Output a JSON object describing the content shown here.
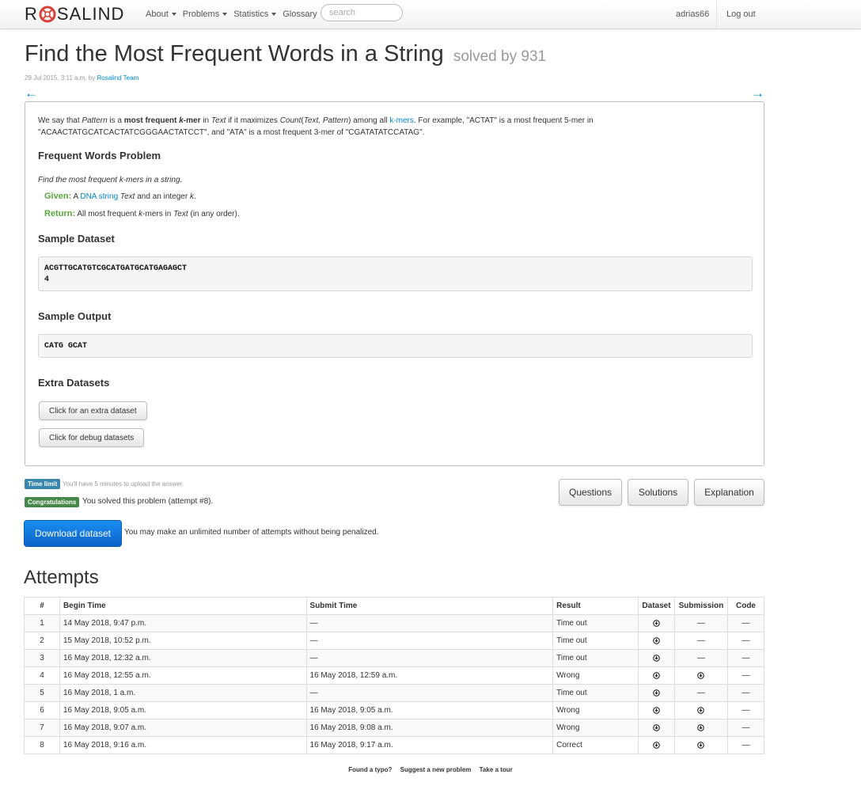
{
  "nav": {
    "brand_left": "R",
    "brand_right": "SALIND",
    "menu": [
      "About",
      "Problems",
      "Statistics",
      "Glossary"
    ],
    "search_placeholder": "search",
    "user": "adrias66",
    "logout": "Log out"
  },
  "problem": {
    "title": "Find the Most Frequent Words in a String",
    "solved_by": "solved by 931",
    "date": "29 Jul 2015, 3:11 a.m. by ",
    "author": "Rosalind Team",
    "prev_arrow": "←",
    "next_arrow": "→",
    "intro": {
      "t1": "We say that ",
      "t2": "Pattern",
      "t3": " is a ",
      "t4": "most frequent ",
      "t5": "k",
      "t6": "-mer",
      "t7": " in ",
      "t8": "Text",
      "t9": " if it maximizes ",
      "t10": "Count",
      "t11": "(",
      "t12": "Text, Pattern",
      "t13": ") among all ",
      "t14": "k-mers",
      "t15": ". For example, \"ACTAT\" is a most frequent 5-mer in \"ACAACTATGCATCACTATCGGGAACTATCCT\", and \"ATA\" is a most frequent 3-mer of \"CGATATATCCATAG\"."
    },
    "section_problem": "Frequent Words Problem",
    "task": "Find the most frequent k-mers in a string.",
    "given_label": "Given:",
    "given_pre": " A ",
    "given_link": "DNA string",
    "given_text": " Text",
    "given_post": " and an integer ",
    "given_k": "k",
    "given_end": ".",
    "return_label": "Return:",
    "return_pre": " All most frequent ",
    "return_k": "k",
    "return_mid": "-mers in ",
    "return_text": "Text",
    "return_post": " (in any order).",
    "section_sample_dataset": "Sample Dataset",
    "sample_dataset_line1": "ACGTTGCATGTCGCATGATGCATGAGAGCT",
    "sample_dataset_line2": "4",
    "section_sample_output": "Sample Output",
    "sample_output": "CATG GCAT",
    "section_extra": "Extra Datasets",
    "extra_button": "Click for an extra dataset",
    "debug_button": "Click for debug datasets"
  },
  "status": {
    "time_limit_badge": "Time limit",
    "time_limit_note": "You'll have 5 minutes to upload the answer.",
    "congrats_badge": "Congratulations",
    "congrats_note": "You solved this problem (attempt #8).",
    "questions": "Questions",
    "solutions": "Solutions",
    "explanation": "Explanation",
    "download": "Download dataset",
    "download_note": "You may make an unlimited number of attempts without being penalized."
  },
  "attempts": {
    "heading": "Attempts",
    "headers": [
      "#",
      "Begin Time",
      "Submit Time",
      "Result",
      "Dataset",
      "Submission",
      "Code"
    ],
    "rows": [
      {
        "n": "1",
        "begin": "14 May 2018, 9:47 p.m.",
        "submit": "—",
        "result": "Time out",
        "submission": "—",
        "code": "—"
      },
      {
        "n": "2",
        "begin": "15 May 2018, 10:52 p.m.",
        "submit": "—",
        "result": "Time out",
        "submission": "—",
        "code": "—"
      },
      {
        "n": "3",
        "begin": "16 May 2018, 12:32 a.m.",
        "submit": "—",
        "result": "Time out",
        "submission": "—",
        "code": "—"
      },
      {
        "n": "4",
        "begin": "16 May 2018, 12:55 a.m.",
        "submit": "16 May 2018, 12:59 a.m.",
        "result": "Wrong",
        "submission": "icon",
        "code": "—"
      },
      {
        "n": "5",
        "begin": "16 May 2018, 1 a.m.",
        "submit": "—",
        "result": "Time out",
        "submission": "—",
        "code": "—"
      },
      {
        "n": "6",
        "begin": "16 May 2018, 9:05 a.m.",
        "submit": "16 May 2018, 9:05 a.m.",
        "result": "Wrong",
        "submission": "icon",
        "code": "—"
      },
      {
        "n": "7",
        "begin": "16 May 2018, 9:07 a.m.",
        "submit": "16 May 2018, 9:08 a.m.",
        "result": "Wrong",
        "submission": "icon",
        "code": "—"
      },
      {
        "n": "8",
        "begin": "16 May 2018, 9:16 a.m.",
        "submit": "16 May 2018, 9:17 a.m.",
        "result": "Correct",
        "submission": "icon",
        "code": "—"
      }
    ]
  },
  "footer": {
    "typo": "Found a typo?",
    "suggest": "Suggest a new problem",
    "tour": "Take a tour"
  },
  "colors": {
    "link": "#0088cc",
    "given_green": "#58a83b",
    "badge_info": "#3a87ad",
    "badge_success": "#468847",
    "primary": "#0a63c9",
    "logo_red": "#d9413a"
  },
  "icons": {
    "dataset": "download-circle-icon",
    "submission": "download-circle-icon",
    "logo": "rosalind-logo-icon"
  }
}
